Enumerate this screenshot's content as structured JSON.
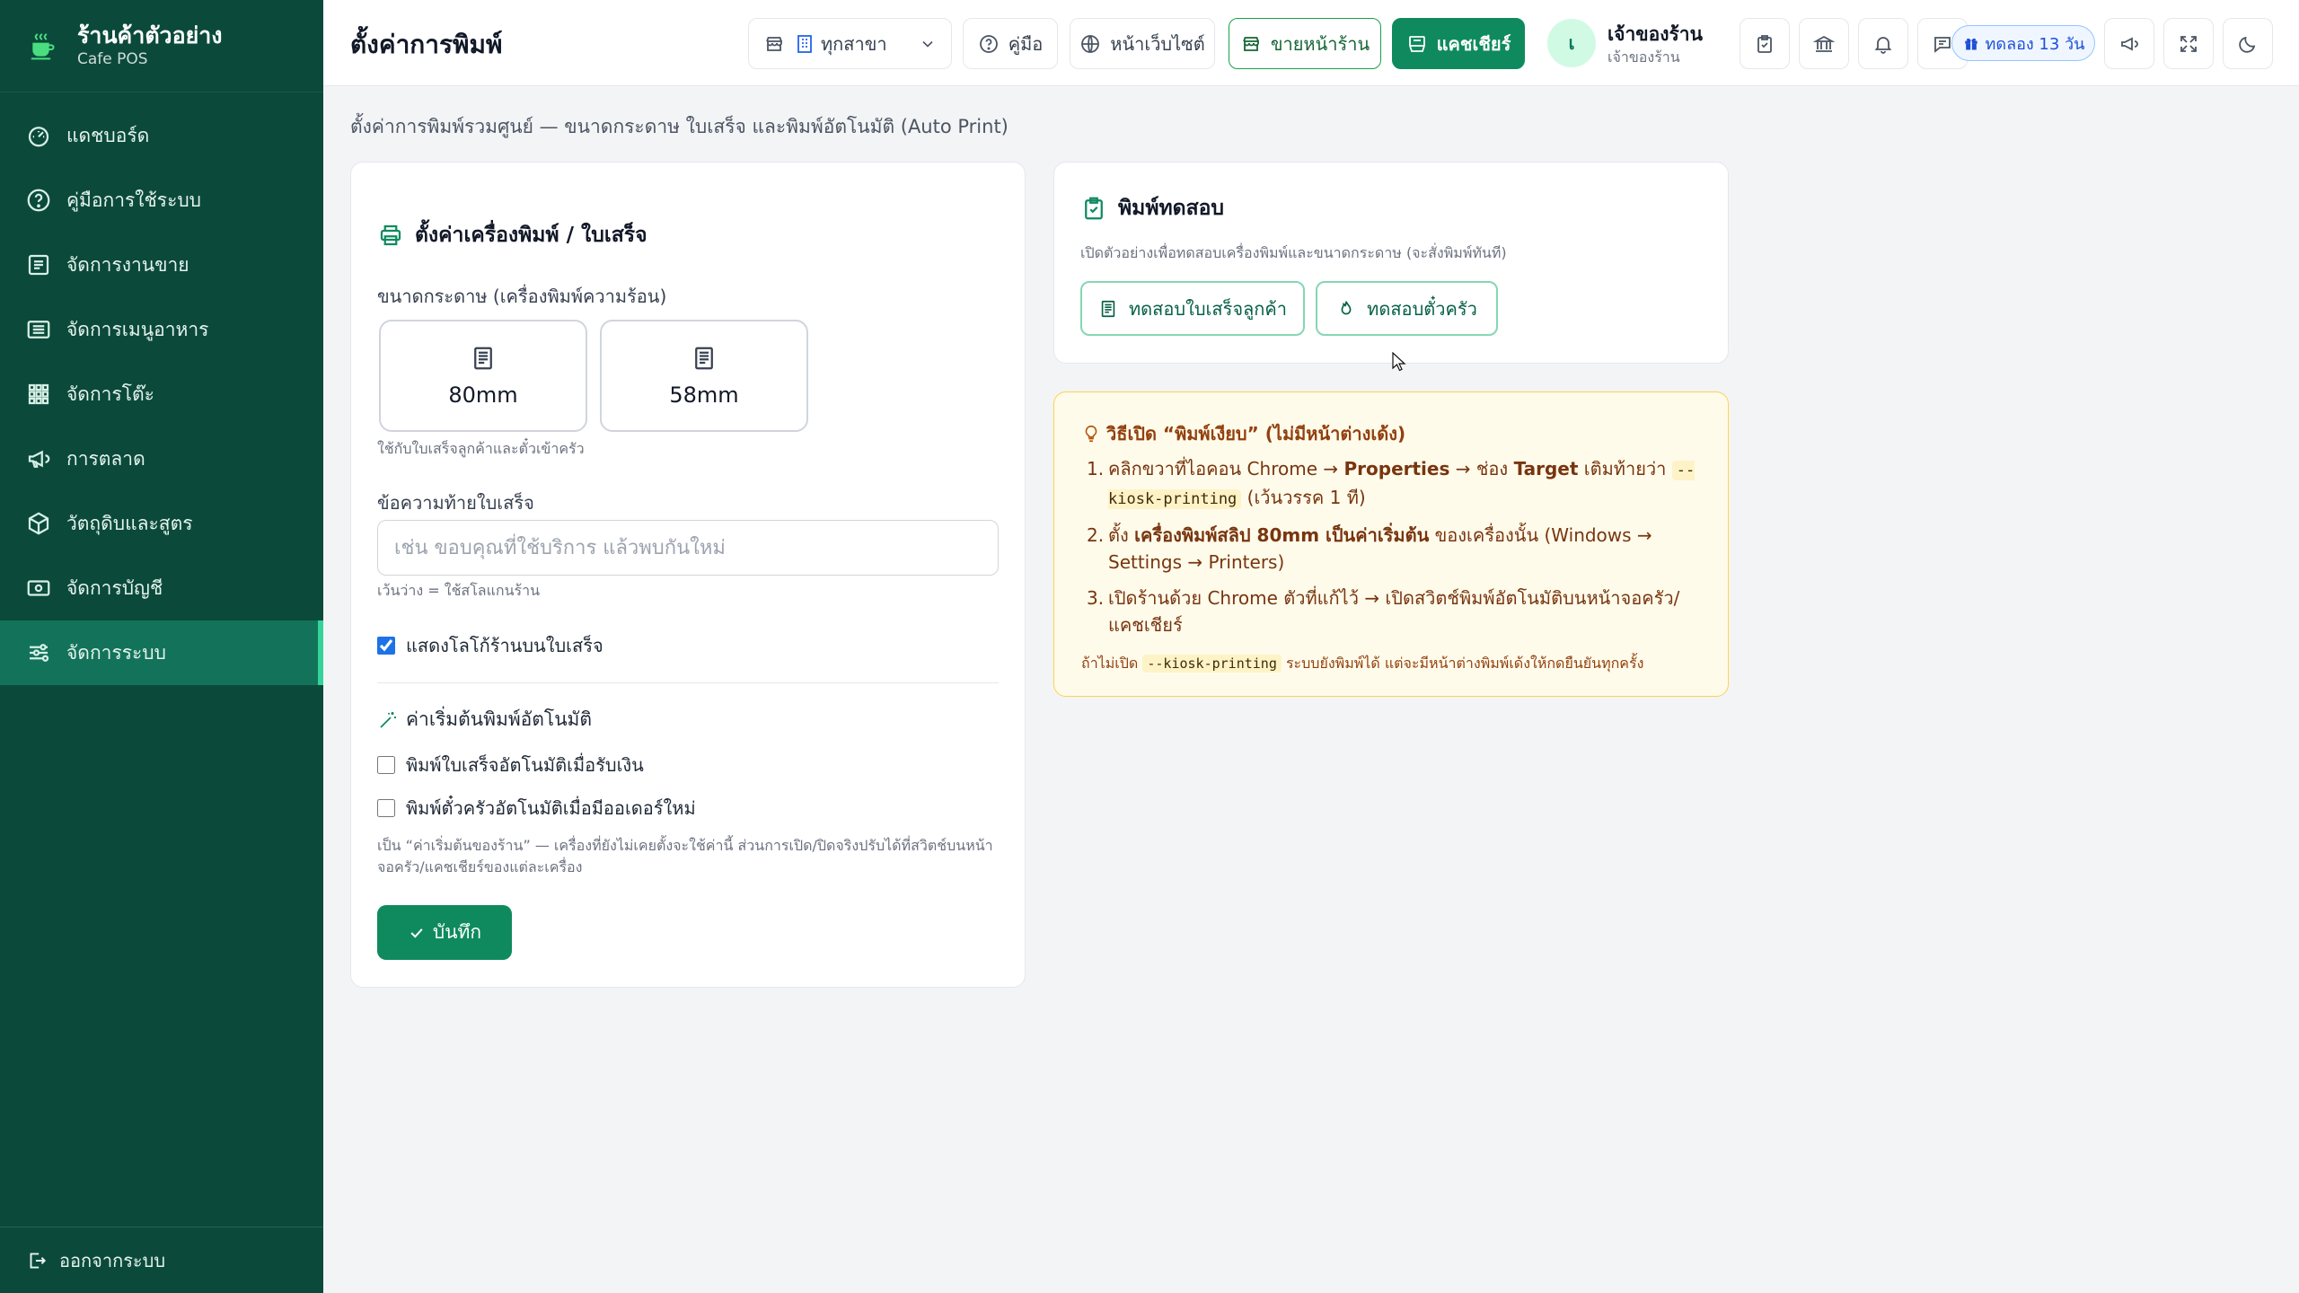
{
  "app": {
    "brand_name": "ร้านค้าตัวอย่าง",
    "brand_sub": "Cafe POS"
  },
  "sidebar": {
    "items": [
      {
        "label": "แดชบอร์ด",
        "icon": "gauge-icon"
      },
      {
        "label": "คู่มือการใช้ระบบ",
        "icon": "help-circle-icon"
      },
      {
        "label": "จัดการงานขาย",
        "icon": "receipt-icon"
      },
      {
        "label": "จัดการเมนูอาหาร",
        "icon": "menu-list-icon"
      },
      {
        "label": "จัดการโต๊ะ",
        "icon": "grid-icon"
      },
      {
        "label": "การตลาด",
        "icon": "megaphone-icon"
      },
      {
        "label": "วัตถุดิบและสูตร",
        "icon": "package-icon"
      },
      {
        "label": "จัดการบัญชี",
        "icon": "banknote-icon"
      },
      {
        "label": "จัดการระบบ",
        "icon": "sliders-icon"
      }
    ],
    "logout_label": "ออกจากระบบ"
  },
  "header": {
    "title": "ตั้งค่าการพิมพ์",
    "branch_select": "ทุกสาขา",
    "manual_label": "คู่มือ",
    "website_label": "หน้าเว็บไซต์",
    "storefront_label": "ขายหน้าร้าน",
    "cashier_label": "แคชเชียร์",
    "avatar_initial": "เ",
    "user_name": "เจ้าของร้าน",
    "user_role": "เจ้าของร้าน",
    "trial_label": "ทดลอง 13 วัน"
  },
  "page": {
    "subtitle": "ตั้งค่าการพิมพ์รวมศูนย์ — ขนาดกระดาษ ใบเสร็จ และพิมพ์อัตโนมัติ (Auto Print)"
  },
  "printer_card": {
    "title": "ตั้งค่าเครื่องพิมพ์ / ใบเสร็จ",
    "paper_label": "ขนาดกระดาษ (เครื่องพิมพ์ความร้อน)",
    "paper_options": [
      "80mm",
      "58mm"
    ],
    "paper_hint": "ใช้กับใบเสร็จลูกค้าและตั๋วเข้าครัว",
    "footer_label": "ข้อความท้ายใบเสร็จ",
    "footer_placeholder": "เช่น ขอบคุณที่ใช้บริการ แล้วพบกันใหม่",
    "footer_hint": "เว้นว่าง = ใช้สโลแกนร้าน",
    "show_logo_label": "แสดงโลโก้ร้านบนใบเสร็จ",
    "show_logo_checked": true,
    "auto_section_label": "ค่าเริ่มต้นพิมพ์อัตโนมัติ",
    "auto_receipt_label": "พิมพ์ใบเสร็จอัตโนมัติเมื่อรับเงิน",
    "auto_receipt_checked": false,
    "auto_kitchen_label": "พิมพ์ตั๋วครัวอัตโนมัติเมื่อมีออเดอร์ใหม่",
    "auto_kitchen_checked": false,
    "auto_hint_1": "เป็น “ค่าเริ่มต้นของร้าน” — เครื่องที่ยังไม่เคยตั้งจะใช้ค่านี้ ส่วนการเปิด/ปิดจริงปรับได้ที่สวิตช์บนหน้า",
    "auto_hint_2": "จอครัว/แคชเชียร์ของแต่ละเครื่อง",
    "save_label": "บันทึก"
  },
  "test_card": {
    "title": "พิมพ์ทดสอบ",
    "hint": "เปิดตัวอย่างเพื่อทดสอบเครื่องพิมพ์และขนาดกระดาษ (จะสั่งพิมพ์ทันที)",
    "receipt_btn": "ทดสอบใบเสร็จลูกค้า",
    "kitchen_btn": "ทดสอบตั๋วครัว"
  },
  "tip_card": {
    "title": "วิธีเปิด “พิมพ์เงียบ” (ไม่มีหน้าต่างเด้ง)",
    "step1_a": "คลิกขวาที่ไอคอน Chrome → ",
    "step1_b": "Properties",
    "step1_c": " → ช่อง ",
    "step1_d": "Target",
    "step1_e": " เติมท้ายว่า ",
    "step1_code": "--kiosk-printing",
    "step1_f": " (เว้นวรรค 1 ที)",
    "step2_a": "ตั้ง ",
    "step2_b": "เครื่องพิมพ์สลิป 80mm เป็นค่าเริ่มต้น",
    "step2_c": " ของเครื่องนั้น (Windows → Settings → Printers)",
    "step3": "เปิดร้านด้วย Chrome ตัวที่แก้ไว้ → เปิดสวิตช์พิมพ์อัตโนมัติบนหน้าจอครัว/แคชเชียร์",
    "foot_a": "ถ้าไม่เปิด ",
    "foot_code": "--kiosk-printing",
    "foot_b": " ระบบยังพิมพ์ได้ แต่จะมีหน้าต่างพิมพ์เด้งให้กดยืนยันทุกครั้ง"
  },
  "colors": {
    "sidebar_bg": "#0b4a3a",
    "accent": "#0f8a5f",
    "tip_bg": "#fffbeb"
  }
}
